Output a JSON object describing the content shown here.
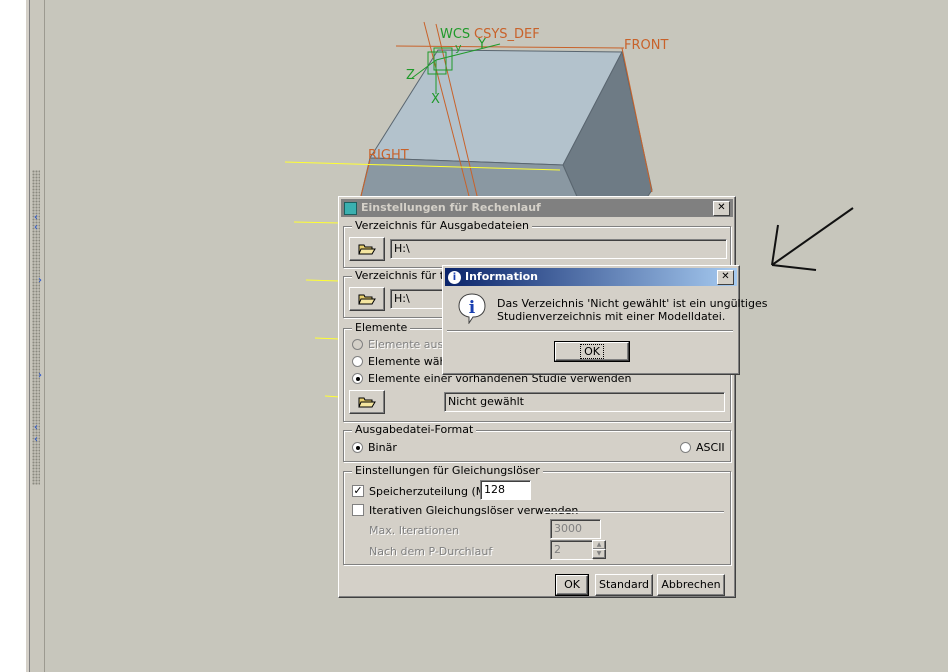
{
  "model": {
    "labels": {
      "wcs": "WCS",
      "csys": "CSYS_DEF",
      "front": "FRONT",
      "right": "RIGHT",
      "axis_x": "X",
      "axis_y": "Y",
      "axis_z": "Z",
      "axis_y2": "y"
    }
  },
  "main_dialog": {
    "title": "Einstellungen für Rechenlauf",
    "close": "✕",
    "output_dir": {
      "legend": "Verzeichnis für Ausgabedateien",
      "value": "H:\\"
    },
    "temp_dir": {
      "legend": "Verzeichnis für te",
      "value": "H:\\"
    },
    "elements": {
      "legend": "Elemente",
      "options": [
        {
          "label": "Elemente aus ve",
          "selected": false,
          "disabled": true
        },
        {
          "label": "Elemente währe",
          "selected": false,
          "disabled": false
        },
        {
          "label": "Elemente einer vorhandenen Studie verwenden",
          "selected": true,
          "disabled": false
        }
      ],
      "study_value": "Nicht gewählt"
    },
    "format": {
      "legend": "Ausgabedatei-Format",
      "binary": "Binär",
      "ascii": "ASCII"
    },
    "solver": {
      "legend": "Einstellungen für Gleichungslöser",
      "memory_label": "Speicherzuteilung (MB)",
      "memory_value": "128",
      "iterative_label": "Iterativen Gleichungslöser verwenden",
      "max_iter_label": "Max. Iterationen",
      "max_iter_value": "3000",
      "p_pass_label": "Nach dem P-Durchlauf",
      "p_pass_value": "2"
    },
    "buttons": {
      "ok": "OK",
      "standard": "Standard",
      "cancel": "Abbrechen"
    }
  },
  "info_dialog": {
    "title": "Information",
    "close": "✕",
    "message_line1": "Das Verzeichnis 'Nicht gewählt' ist ein ungültiges",
    "message_line2": "Studienverzeichnis mit einer Modelldatei.",
    "ok": "OK"
  },
  "colors": {
    "model_top": "#b3c2cc",
    "model_front": "#6e7b85",
    "model_side": "#8a98a2",
    "datum": "#c8622a",
    "csys": "#1f9a2a"
  }
}
